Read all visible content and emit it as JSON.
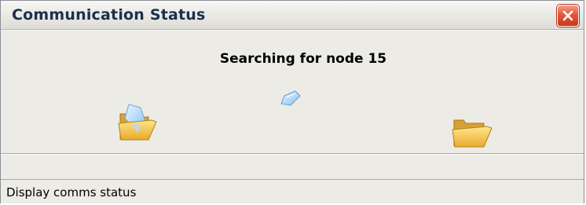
{
  "window": {
    "title": "Communication Status",
    "close_icon": "close-icon"
  },
  "main": {
    "status_message": "Searching for node 15",
    "icons": {
      "source": "open-folder-with-document-icon",
      "transfer": "flying-document-icon",
      "target": "open-folder-icon"
    }
  },
  "statusbar": {
    "text": "Display comms status"
  },
  "colors": {
    "title_text": "#1c2f4f",
    "close_button": "#e2573a",
    "folder": "#f3c24c",
    "document": "#a9d4ff"
  }
}
